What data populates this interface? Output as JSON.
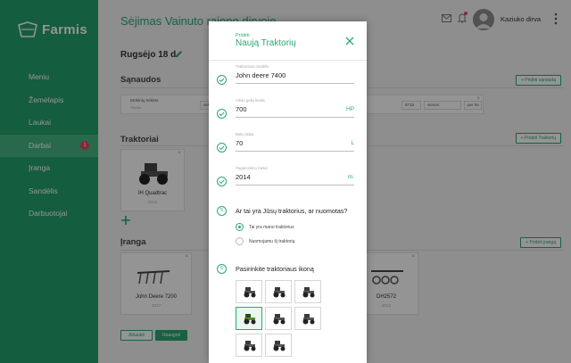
{
  "app": {
    "logo_text": "Farmis"
  },
  "sidebar": {
    "items": [
      {
        "label": "Meniu"
      },
      {
        "label": "Žemėlapis"
      },
      {
        "label": "Laukai"
      },
      {
        "label": "Darbai",
        "badge": "1"
      },
      {
        "label": "Įranga"
      },
      {
        "label": "Sandėlis"
      },
      {
        "label": "Darbuotojai"
      }
    ]
  },
  "header": {
    "title": "Sėjimas Vainuto rajono dirvoje",
    "user_name": "Kaziuko dirva"
  },
  "main": {
    "date": "Rugsėjo 18 d.",
    "expenses": {
      "title": "Sąnaudos",
      "add_label": "+ Pridėti sąnaudą",
      "row_label": "Mokinių sėklos",
      "row_sub": "Sėklos",
      "row_field1": "sėkl",
      "row_field2": "8715",
      "row_field3": "vienos",
      "row_field4": "per ha"
    },
    "tractors": {
      "title": "Traktoriai",
      "add_label": "+ Pridėti Traktorių",
      "cards": [
        {
          "name": "IH Quadtrac",
          "year": "2016"
        }
      ]
    },
    "equipment": {
      "title": "Įranga",
      "add_label": "+ Pridėti įrangą",
      "cards": [
        {
          "name": "John Deere 7200",
          "year": "2017"
        },
        {
          "name": "DH2572",
          "year": "2014"
        }
      ]
    },
    "buttons": {
      "cancel": "Atšaukti",
      "save": "Išsaugoti"
    }
  },
  "modal": {
    "subtitle": "Pridėti",
    "title": "Naują Traktorių",
    "fields": [
      {
        "label": "Traktoriaus modelis",
        "value": "John deere 7400",
        "unit": ""
      },
      {
        "label": "Arklio galių kiekis",
        "value": "700",
        "unit": "HP"
      },
      {
        "label": "Bako talpa",
        "value": "70",
        "unit": "L"
      },
      {
        "label": "Pagaminimo metai",
        "value": "2014",
        "unit": "m."
      }
    ],
    "ownership": {
      "step": "5",
      "question": "Ar tai yra Jūsų traktorius, ar nuomotas?",
      "options": [
        {
          "label": "Tai yra mano traktorius",
          "selected": true
        },
        {
          "label": "Nuomojamu šį traktorių",
          "selected": false
        }
      ]
    },
    "icon_picker": {
      "step": "6",
      "question": "Pasirinkite traktoriaus ikoną",
      "icon_name": "tractor-icon",
      "selected_index": 3
    }
  },
  "colors": {
    "brand": "#24a16b",
    "accent": "#2aa874",
    "badge": "#e04a5f"
  }
}
